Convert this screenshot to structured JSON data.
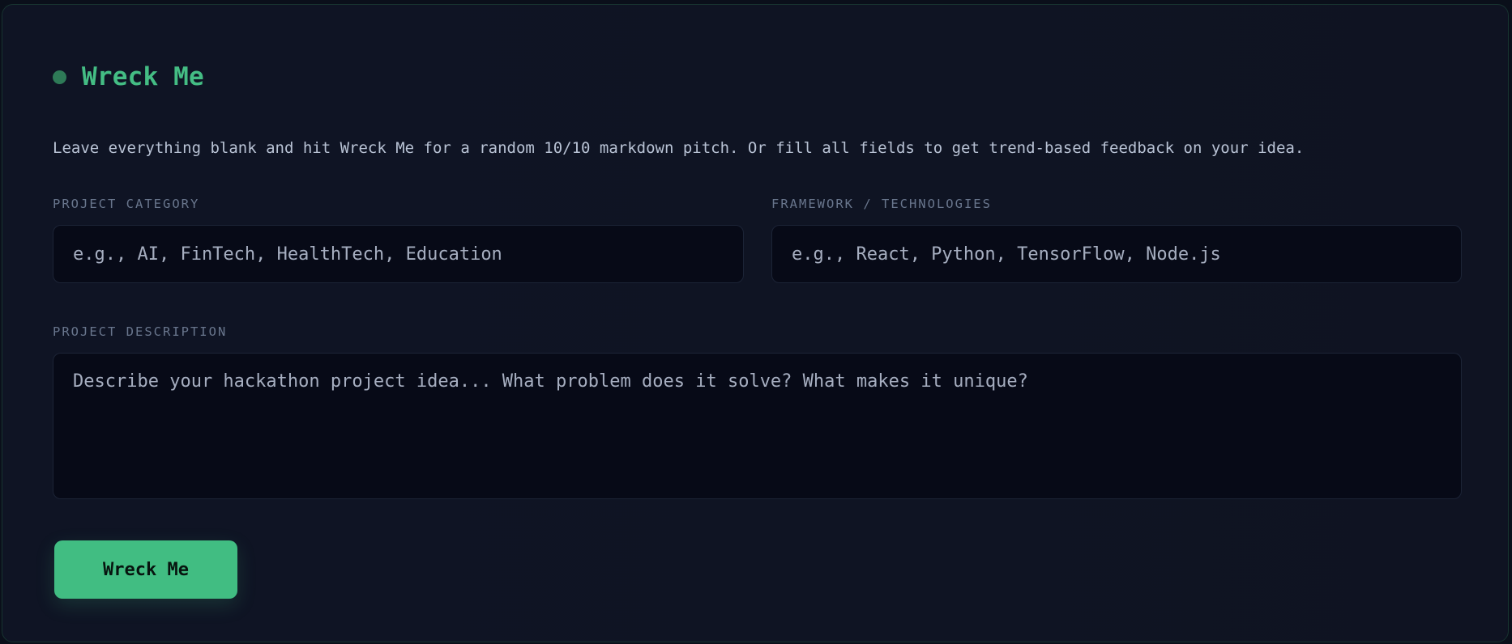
{
  "header": {
    "title": "Wreck Me",
    "dot_icon": "status-dot-icon"
  },
  "intro_text": "Leave everything blank and hit Wreck Me for a random 10/10 markdown pitch. Or fill all fields to get trend-based feedback on your idea.",
  "form": {
    "category": {
      "label": "PROJECT CATEGORY",
      "placeholder": "e.g., AI, FinTech, HealthTech, Education",
      "value": ""
    },
    "framework": {
      "label": "FRAMEWORK / TECHNOLOGIES",
      "placeholder": "e.g., React, Python, TensorFlow, Node.js",
      "value": ""
    },
    "description": {
      "label": "PROJECT DESCRIPTION",
      "placeholder": "Describe your hackathon project idea... What problem does it solve? What makes it unique?",
      "value": ""
    },
    "submit_label": "Wreck Me"
  },
  "colors": {
    "accent": "#41bd82",
    "title": "#44bd84",
    "background": "#0f1424",
    "field_background": "#070a17"
  }
}
